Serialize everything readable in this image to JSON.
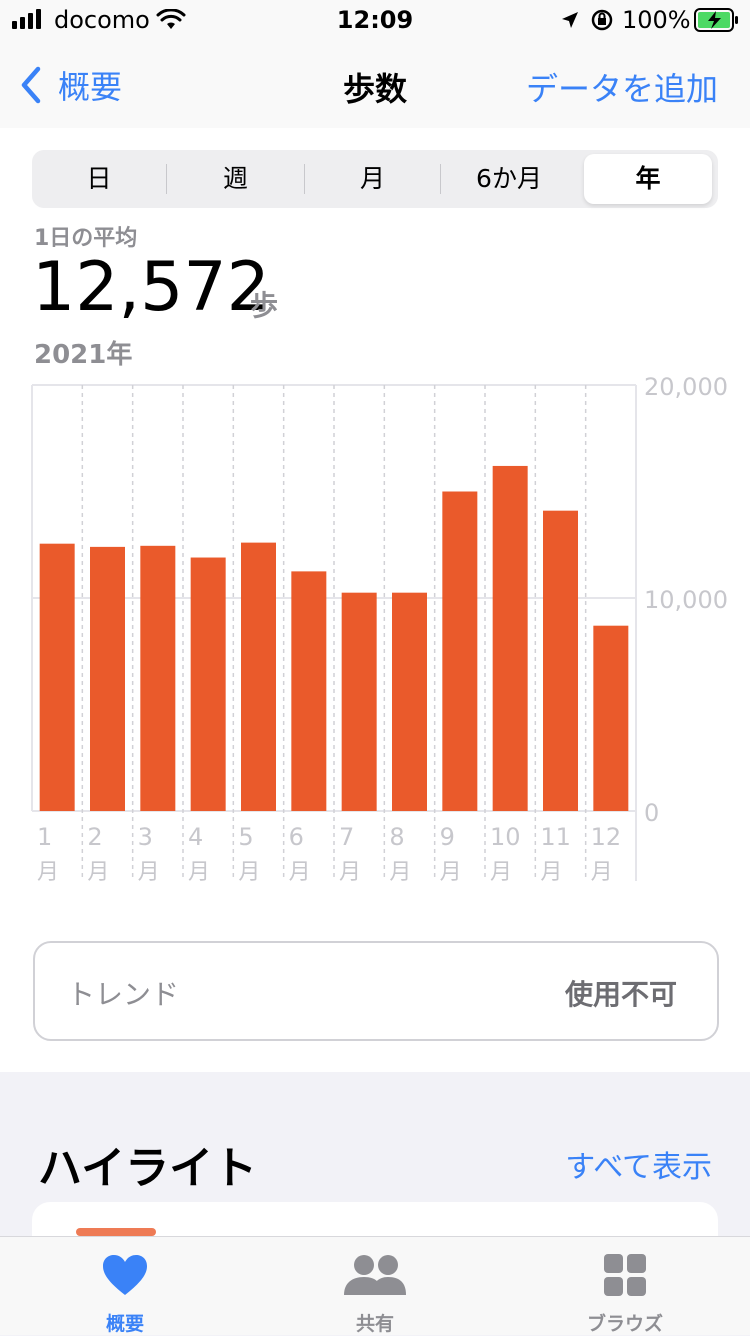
{
  "status_bar": {
    "carrier": "docomo",
    "time": "12:09",
    "battery": "100%"
  },
  "nav": {
    "back_label": "概要",
    "title": "歩数",
    "action_label": "データを追加"
  },
  "segments": [
    "日",
    "週",
    "月",
    "6か月",
    "年"
  ],
  "selected_segment": "年",
  "summary": {
    "label": "1日の平均",
    "value": "12,572",
    "unit": "歩",
    "period": "2021年"
  },
  "chart_data": {
    "type": "bar",
    "categories": [
      "1月",
      "2月",
      "3月",
      "4月",
      "5月",
      "6月",
      "7月",
      "8月",
      "9月",
      "10月",
      "11月",
      "12月"
    ],
    "values": [
      12550,
      12400,
      12450,
      11900,
      12600,
      11250,
      10250,
      10250,
      15000,
      16200,
      14100,
      8700
    ],
    "ylim": [
      0,
      20000
    ],
    "y_ticks": [
      "0",
      "10,000",
      "20,000"
    ],
    "color": "#ea5a2b",
    "grid": true
  },
  "trend": {
    "label": "トレンド",
    "status": "使用不可"
  },
  "highlights": {
    "title": "ハイライト",
    "show_all": "すべて表示"
  },
  "tabs": [
    {
      "label": "概要",
      "icon": "heart-icon"
    },
    {
      "label": "共有",
      "icon": "people-icon"
    },
    {
      "label": "ブラウズ",
      "icon": "grid-icon"
    }
  ],
  "colors": {
    "accent": "#3a82f7",
    "bar": "#ea5a2b"
  }
}
